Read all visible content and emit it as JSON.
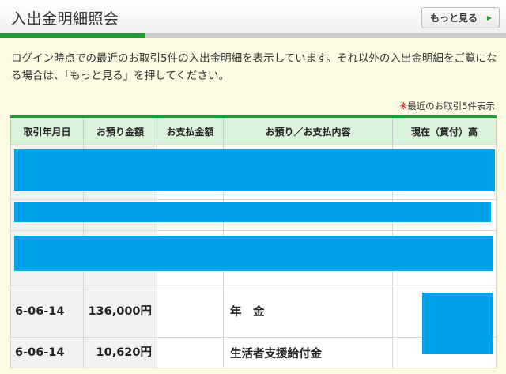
{
  "header": {
    "title": "入出金明細照会",
    "more_button": "もっと見る"
  },
  "description": "ログイン時点での最近のお取引5件の入出金明細を表示しています。それ以外の入出金明細をご覧になる場合は、「もっと見る」を押してください。",
  "note": {
    "mark": "※",
    "text": "最近のお取引5件表示"
  },
  "table": {
    "columns": [
      "取引年月日",
      "お預り金額",
      "お支払金額",
      "お預り／お支払内容",
      "現在（貸付）高"
    ],
    "rows": [
      {
        "date": "",
        "deposit": "",
        "payment": "",
        "description": "",
        "balance": "",
        "redacted": true
      },
      {
        "date": "",
        "deposit": "",
        "payment": "",
        "description": "",
        "balance": "",
        "redacted": true
      },
      {
        "date": "",
        "deposit": "",
        "payment": "",
        "description": "",
        "balance": "",
        "redacted": true
      },
      {
        "date": "6-06-14",
        "deposit": "136,000円",
        "payment": "",
        "description": "年　金",
        "balance": "",
        "redacted": false
      },
      {
        "date": "6-06-14",
        "deposit": "10,620円",
        "payment": "",
        "description": "生活者支援給付金",
        "balance": "",
        "redacted": false
      }
    ]
  },
  "colors": {
    "accent_green": "#1f9b35",
    "header_green": "#d9f2d9",
    "redaction_blue": "#00a2e8",
    "background": "#fbfbe3"
  }
}
